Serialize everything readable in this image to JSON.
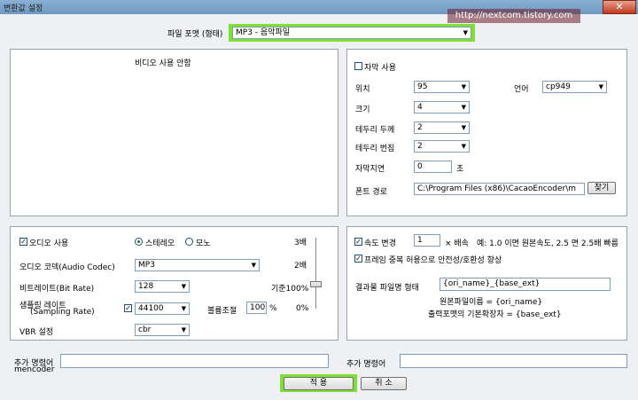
{
  "window": {
    "title": "변환값 설정",
    "watermark_url": "http://nextcom.tistory.com",
    "close_icon": "✕"
  },
  "file_format": {
    "label": "파일 포맷 (형태)",
    "value": "MP3 - 음악파일"
  },
  "video": {
    "message": "비디오 사용 안함"
  },
  "subtitle": {
    "enabled_label": "자막 사용",
    "position_label": "위치",
    "position_value": "95",
    "language_label": "언어",
    "language_value": "cp949",
    "size_label": "크기",
    "size_value": "4",
    "border_width_label": "테두리 두께",
    "border_width_value": "2",
    "border_blur_label": "테두리 번짐",
    "border_blur_value": "2",
    "delay_label": "자막지연",
    "delay_value": "0",
    "delay_unit": "초",
    "font_path_label": "폰트 경로",
    "font_path_value": "C:\\Program Files (x86)\\CacaoEncoder\\m",
    "browse_label": "찾기"
  },
  "audio": {
    "enabled_label": "오디오 사용",
    "stereo_label": "스테레오",
    "mono_label": "모노",
    "codec_label": "오디오 코덱(Audio Codec)",
    "codec_value": "MP3",
    "bitrate_label": "비트레이트(Bit Rate)",
    "bitrate_value": "128",
    "sampling_label_1": "샘플링 레이트",
    "sampling_label_2": "(Sampling Rate)",
    "sampling_value": "44100",
    "volume_label": "볼륨조절",
    "volume_value": "100",
    "volume_unit": "%",
    "vbr_label": "VBR 설정",
    "vbr_value": "cbr",
    "scale": {
      "top": "3배",
      "mid": "2배",
      "base": "기준100%",
      "zero": "0%"
    }
  },
  "speed": {
    "enabled_label": "속도 변경",
    "value": "1",
    "unit": "× 배속",
    "example": "예: 1.0 이면 원본속도, 2.5 면 2.5배 빠름",
    "frame_dup_label": "프레임 중복 허용으로 안전성/호환성 향상",
    "output_name_label": "결과물 파일명 형태",
    "output_name_value": "{ori_name}_{base_ext}",
    "hint_1": "원본파일이름 = {ori_name}",
    "hint_2": "출력포맷의 기본확장자 = {base_ext}"
  },
  "extra": {
    "mencoder_label_1": "추가 명령어",
    "mencoder_label_2": "mencoder",
    "mencoder_value": "",
    "label_2": "추가 명령어",
    "value_2": ""
  },
  "buttons": {
    "apply": "적 용",
    "cancel": "취 소"
  },
  "colors": {
    "highlight": "#7de033",
    "titlebar": "#7aa2c9",
    "close": "#c1381c"
  }
}
